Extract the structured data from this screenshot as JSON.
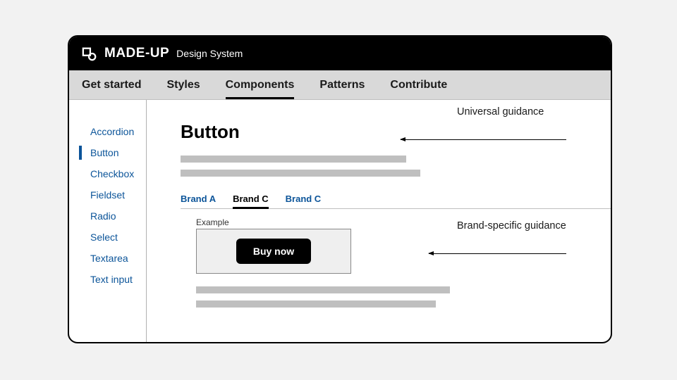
{
  "brand": {
    "name": "MADE-UP",
    "sub": "Design System"
  },
  "nav": {
    "items": [
      {
        "label": "Get started",
        "active": false
      },
      {
        "label": "Styles",
        "active": false
      },
      {
        "label": "Components",
        "active": true
      },
      {
        "label": "Patterns",
        "active": false
      },
      {
        "label": "Contribute",
        "active": false
      }
    ]
  },
  "sidebar": {
    "items": [
      {
        "label": "Accordion",
        "active": false
      },
      {
        "label": "Button",
        "active": true
      },
      {
        "label": "Checkbox",
        "active": false
      },
      {
        "label": "Fieldset",
        "active": false
      },
      {
        "label": "Radio",
        "active": false
      },
      {
        "label": "Select",
        "active": false
      },
      {
        "label": "Textarea",
        "active": false
      },
      {
        "label": "Text input",
        "active": false
      }
    ]
  },
  "page": {
    "title": "Button",
    "brand_tabs": [
      {
        "label": "Brand A",
        "active": false
      },
      {
        "label": "Brand C",
        "active": true
      },
      {
        "label": "Brand C",
        "active": false
      }
    ],
    "example_label": "Example",
    "example_button": "Buy now"
  },
  "annotations": {
    "universal": "Universal guidance",
    "brand_specific": "Brand-specific guidance"
  }
}
